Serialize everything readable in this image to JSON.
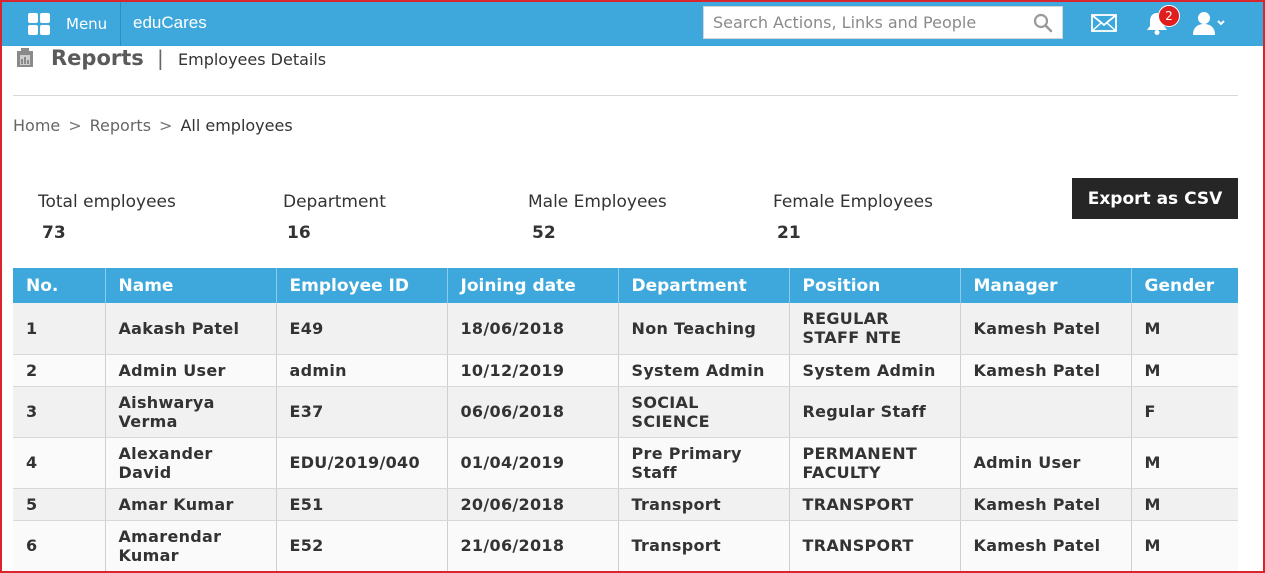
{
  "topbar": {
    "menu_label": "Menu",
    "brand": "eduCares",
    "search_placeholder": "Search Actions, Links and People",
    "notification_count": "2"
  },
  "header": {
    "title": "Reports",
    "separator": "|",
    "subtitle": "Employees Details"
  },
  "breadcrumb": {
    "items": [
      "Home",
      "Reports",
      "All employees"
    ],
    "separator": ">"
  },
  "stats": [
    {
      "label": "Total employees",
      "value": "73"
    },
    {
      "label": "Department",
      "value": "16"
    },
    {
      "label": "Male Employees",
      "value": "52"
    },
    {
      "label": "Female Employees",
      "value": "21"
    }
  ],
  "export_label": "Export as CSV",
  "table": {
    "columns": [
      "No.",
      "Name",
      "Employee ID",
      "Joining date",
      "Department",
      "Position",
      "Manager",
      "Gender"
    ],
    "rows": [
      [
        "1",
        "Aakash Patel",
        "E49",
        "18/06/2018",
        "Non Teaching",
        "REGULAR STAFF NTE",
        "Kamesh Patel",
        "M"
      ],
      [
        "2",
        "Admin User",
        "admin",
        "10/12/2019",
        "System Admin",
        "System Admin",
        "Kamesh Patel",
        "M"
      ],
      [
        "3",
        "Aishwarya Verma",
        "E37",
        "06/06/2018",
        "SOCIAL SCIENCE",
        "Regular Staff",
        "",
        "F"
      ],
      [
        "4",
        "Alexander David",
        "EDU/2019/040",
        "01/04/2019",
        "Pre Primary Staff",
        "PERMANENT FACULTY",
        "Admin User",
        "M"
      ],
      [
        "5",
        "Amar Kumar",
        "E51",
        "20/06/2018",
        "Transport",
        "TRANSPORT",
        "Kamesh Patel",
        "M"
      ],
      [
        "6",
        "Amarendar Kumar",
        "E52",
        "21/06/2018",
        "Transport",
        "TRANSPORT",
        "Kamesh Patel",
        "M"
      ]
    ]
  },
  "colors": {
    "topbar": "#3ea8dc",
    "table_header": "#3ea8dc",
    "export_button": "#262626",
    "badge": "#e01e1e",
    "frame": "#d9262e"
  }
}
